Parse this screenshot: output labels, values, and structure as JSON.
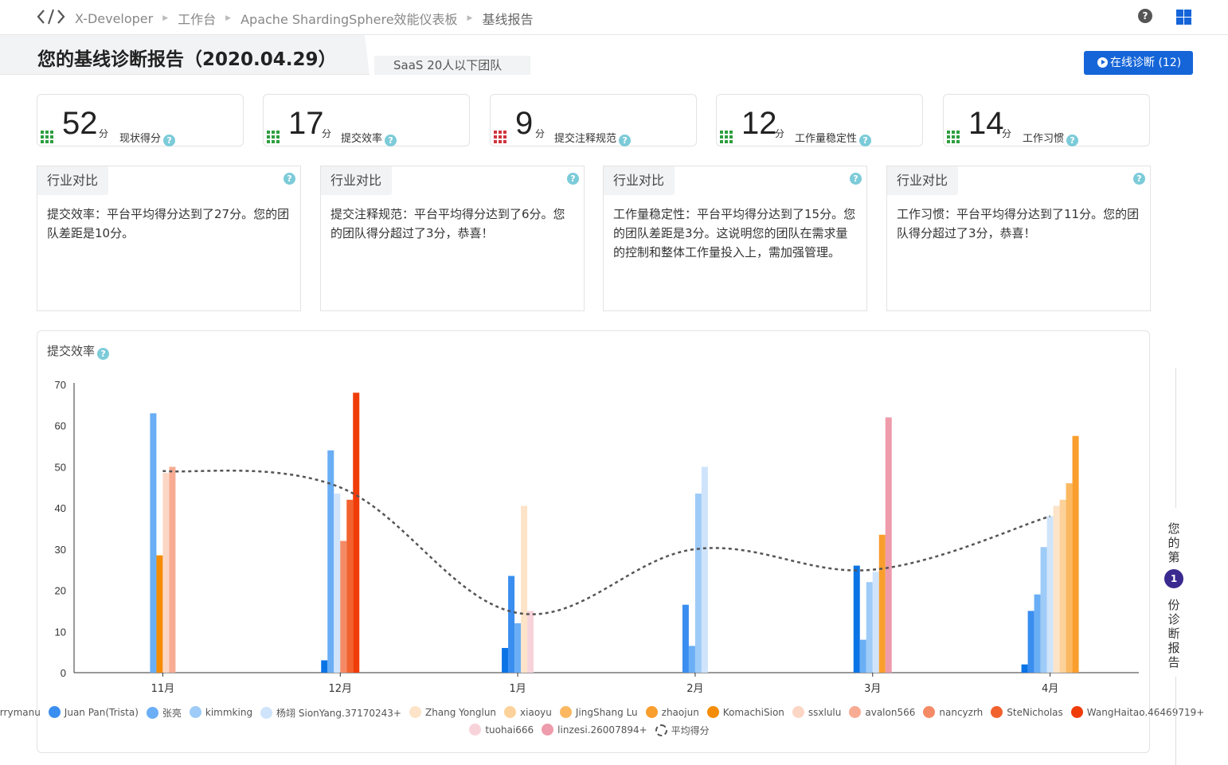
{
  "nav": {
    "brand": "X-Developer",
    "crumbs": [
      "工作台",
      "Apache ShardingSphere效能仪表板",
      "基线报告"
    ],
    "help_glyph": "?",
    "help_icon": "question-circle-icon",
    "apps_icon": "grid-apps-icon"
  },
  "header": {
    "title": "您的基线诊断报告（2020.04.29）",
    "scope_tag": "SaaS   20人以下团队",
    "diag_button": "在线诊断 (12)"
  },
  "score_cards": [
    {
      "value": "52",
      "unit": "分",
      "label": "现状得分",
      "dot_color": "#2e9e3e"
    },
    {
      "value": "17",
      "unit": "分",
      "label": "提交效率",
      "dot_color": "#2e9e3e"
    },
    {
      "value": "9",
      "unit": "分",
      "label": "提交注释规范",
      "dot_color": "#d0343c"
    },
    {
      "value": "12",
      "unit": "分",
      "label": "工作量稳定性",
      "dot_color": "#2e9e3e"
    },
    {
      "value": "14",
      "unit": "分",
      "label": "工作习惯",
      "dot_color": "#2e9e3e"
    }
  ],
  "compare_cards": [
    {
      "tab": "行业对比",
      "text": "提交效率：平台平均得分达到了27分。您的团队差距是10分。"
    },
    {
      "tab": "行业对比",
      "text": "提交注释规范：平台平均得分达到了6分。您的团队得分超过了3分，恭喜！"
    },
    {
      "tab": "行业对比",
      "text": "工作量稳定性：平台平均得分达到了15分。您的团队差距是3分。这说明您的团队在需求量的控制和整体工作量投入上，需加强管理。"
    },
    {
      "tab": "行业对比",
      "text": "工作习惯：平台平均得分达到了11分。您的团队得分超过了3分，恭喜！"
    }
  ],
  "chart_panel": {
    "title": "提交效率"
  },
  "side_rail": {
    "before": "您的第",
    "badge": "1",
    "after": "份诊断报告"
  },
  "chart_data": {
    "type": "bar",
    "title": "提交效率",
    "categories": [
      "11月",
      "12月",
      "1月",
      "2月",
      "3月",
      "4月"
    ],
    "ylim": [
      0,
      70
    ],
    "yticks": [
      0,
      10,
      20,
      30,
      40,
      50,
      60,
      70
    ],
    "grid": false,
    "legend_position": "bottom",
    "series": [
      {
        "name": "terrymanu",
        "color": "#0a74e6",
        "values": [
          null,
          3,
          6,
          null,
          26,
          2
        ]
      },
      {
        "name": "Juan Pan(Trista)",
        "color": "#3a8ef0",
        "values": [
          null,
          null,
          23.5,
          16.5,
          null,
          15
        ]
      },
      {
        "name": "张亮",
        "color": "#6aaef5",
        "values": [
          63,
          54,
          12,
          6.5,
          8,
          19
        ]
      },
      {
        "name": "kimmking",
        "color": "#9ecbf7",
        "values": [
          null,
          null,
          null,
          43.5,
          22,
          30.5
        ]
      },
      {
        "name": "杨翊 SionYang.37170243+",
        "color": "#cfe4fb",
        "values": [
          null,
          43.5,
          null,
          50,
          24.5,
          38
        ]
      },
      {
        "name": "Zhang Yonglun",
        "color": "#fde3c8",
        "values": [
          null,
          null,
          40.5,
          null,
          null,
          40.5
        ]
      },
      {
        "name": "xiaoyu",
        "color": "#fcd29a",
        "values": [
          null,
          null,
          null,
          null,
          null,
          42
        ]
      },
      {
        "name": "JingShang Lu",
        "color": "#fbb860",
        "values": [
          null,
          null,
          null,
          null,
          null,
          46
        ]
      },
      {
        "name": "zhaojun",
        "color": "#fa9e2d",
        "values": [
          null,
          null,
          null,
          null,
          33.5,
          57.5
        ]
      },
      {
        "name": "KomachiSion",
        "color": "#f48c06",
        "values": [
          28.5,
          null,
          null,
          null,
          null,
          null
        ]
      },
      {
        "name": "ssxlulu",
        "color": "#fcd6c4",
        "values": [
          48.5,
          null,
          null,
          null,
          null,
          null
        ]
      },
      {
        "name": "avalon566",
        "color": "#f8ab93",
        "values": [
          50,
          null,
          null,
          null,
          null,
          null
        ]
      },
      {
        "name": "nancyzrh",
        "color": "#f58a66",
        "values": [
          null,
          32,
          null,
          null,
          null,
          null
        ]
      },
      {
        "name": "SteNicholas",
        "color": "#f2622e",
        "values": [
          null,
          42,
          null,
          null,
          null,
          null
        ]
      },
      {
        "name": "WangHaitao.46469719+",
        "color": "#f03c08",
        "values": [
          null,
          68,
          null,
          null,
          null,
          null
        ]
      },
      {
        "name": "tuohai666",
        "color": "#f7d3d9",
        "values": [
          null,
          null,
          15,
          null,
          null,
          null
        ]
      },
      {
        "name": "linzesi.26007894+",
        "color": "#ee9bab",
        "values": [
          null,
          null,
          null,
          null,
          62,
          null
        ]
      }
    ],
    "average": {
      "name": "平均得分",
      "color": "#555555",
      "style": "dashed",
      "values": [
        49,
        45,
        14.5,
        30,
        25,
        38
      ]
    }
  }
}
